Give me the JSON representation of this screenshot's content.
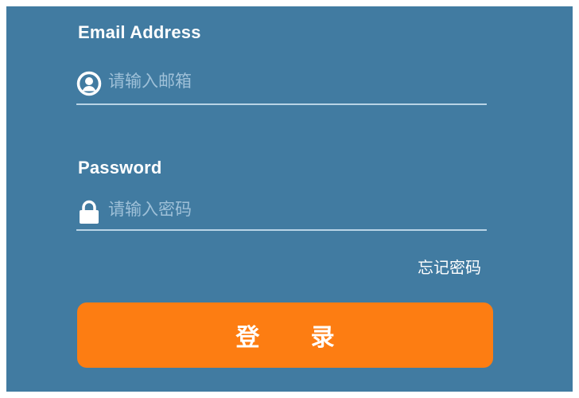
{
  "form": {
    "email": {
      "label": "Email Address",
      "placeholder": "请输入邮箱",
      "value": "",
      "icon": "user-icon"
    },
    "password": {
      "label": "Password",
      "placeholder": "请输入密码",
      "value": "",
      "icon": "lock-icon"
    },
    "forgot_label": "忘记密码",
    "login_label": "登 录"
  },
  "colors": {
    "panel_background": "#417ba1",
    "button_background": "#fd7d12",
    "text": "#ffffff",
    "placeholder": "#9ec0d8",
    "underline": "#b9d4e6"
  }
}
